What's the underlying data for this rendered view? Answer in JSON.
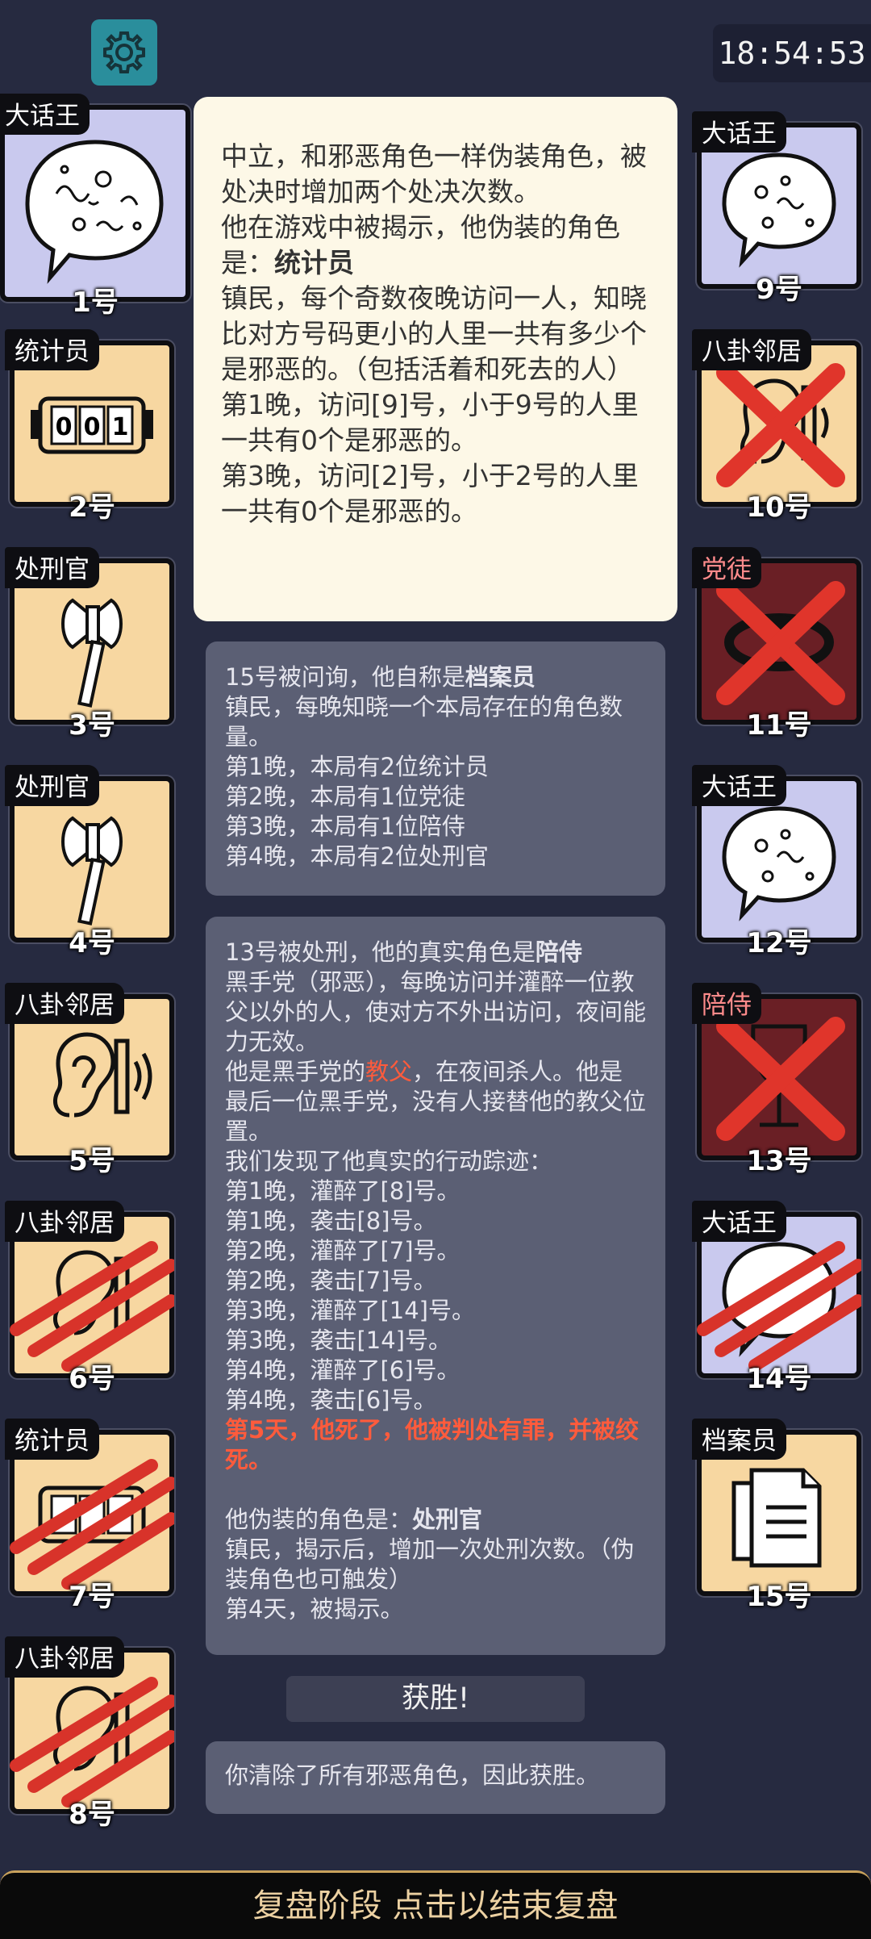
{
  "clock": "18:54:53",
  "left_cards": [
    {
      "role": "大话王",
      "num": "1号",
      "type": "liar",
      "state": "alive",
      "icon": "speech-bubble-icon"
    },
    {
      "role": "统计员",
      "num": "2号",
      "type": "town",
      "state": "alive",
      "icon": "counter-icon",
      "counter": "001"
    },
    {
      "role": "处刑官",
      "num": "3号",
      "type": "town",
      "state": "alive",
      "icon": "axe-icon"
    },
    {
      "role": "处刑官",
      "num": "4号",
      "type": "town",
      "state": "alive",
      "icon": "axe-icon"
    },
    {
      "role": "八卦邻居",
      "num": "5号",
      "type": "town",
      "state": "alive",
      "icon": "ear-icon"
    },
    {
      "role": "八卦邻居",
      "num": "6号",
      "type": "town",
      "state": "killed",
      "icon": "ear-icon"
    },
    {
      "role": "统计员",
      "num": "7号",
      "type": "town",
      "state": "killed",
      "icon": "counter-icon"
    },
    {
      "role": "八卦邻居",
      "num": "8号",
      "type": "town",
      "state": "killed",
      "icon": "ear-icon"
    }
  ],
  "right_cards": [
    {
      "role": "大话王",
      "num": "9号",
      "type": "liar",
      "state": "alive",
      "icon": "speech-bubble-icon"
    },
    {
      "role": "八卦邻居",
      "num": "10号",
      "type": "town",
      "state": "executed",
      "icon": "ear-icon"
    },
    {
      "role": "党徒",
      "num": "11号",
      "type": "evil",
      "state": "executed",
      "icon": "ring-icon"
    },
    {
      "role": "大话王",
      "num": "12号",
      "type": "liar",
      "state": "alive",
      "icon": "speech-bubble-icon"
    },
    {
      "role": "陪侍",
      "num": "13号",
      "type": "evil",
      "state": "executed",
      "icon": "wine-glass-icon"
    },
    {
      "role": "大话王",
      "num": "14号",
      "type": "liar",
      "state": "killed",
      "icon": "speech-bubble-icon"
    },
    {
      "role": "档案员",
      "num": "15号",
      "type": "town",
      "state": "alive",
      "icon": "documents-icon"
    }
  ],
  "main_panel": {
    "line1": "中立，和邪恶角色一样伪装角色，被处决时增加两个处决次数。",
    "line2a": "他在游戏中被揭示，他伪装的角色是：",
    "line2b": "统计员",
    "line3": "镇民，每个奇数夜晚访问一人，知晓比对方号码更小的人里一共有多少个是邪恶的。（包括活着和死去的人）",
    "line4": "第1晚，访问[9]号，小于9号的人里一共有0个是邪恶的。",
    "line5": "第3晚，访问[2]号，小于2号的人里一共有0个是邪恶的。"
  },
  "log1": {
    "head_a": "15号被问询，他自称是",
    "head_b": "档案员",
    "desc": "镇民，每晚知晓一个本局存在的角色数量。",
    "lines": [
      "第1晚，本局有2位统计员",
      "第2晚，本局有1位党徒",
      "第3晚，本局有1位陪侍",
      "第4晚，本局有2位处刑官"
    ]
  },
  "log2": {
    "head_a": "13号被处刑，他的真实角色是",
    "head_b": "陪侍",
    "desc": "黑手党（邪恶），每晚访问并灌醉一位教父以外的人，使对方不外出访问，夜间能力无效。",
    "boss_a": "他是黑手党的",
    "boss_b": "教父",
    "boss_c": "，在夜间杀人。他是最后一位黑手党，没有人接替他的教父位置。",
    "trace_head": "我们发现了他真实的行动踪迹：",
    "lines": [
      "第1晚，灌醉了[8]号。",
      "第1晚，袭击[8]号。",
      "第2晚，灌醉了[7]号。",
      "第2晚，袭击[7]号。",
      "第3晚，灌醉了[14]号。",
      "第3晚，袭击[14]号。",
      "第4晚，灌醉了[6]号。",
      "第4晚，袭击[6]号。"
    ],
    "death": "第5天，他死了，他被判处有罪，并被绞死。",
    "disguise_a": "他伪装的角色是：",
    "disguise_b": "处刑官",
    "disguise_desc": "镇民，揭示后，增加一次处刑次数。（伪装角色也可触发）",
    "revealed": "第4天，被揭示。"
  },
  "win_label": "获胜!",
  "win_text": "你清除了所有邪恶角色，因此获胜。",
  "bottom_bar": "复盘阶段 点击以结束复盘",
  "colors": {
    "town": "#f7d7a1",
    "liar": "#c9c9ee",
    "evil": "#6a1f25",
    "mark": "#e0352b",
    "accent": "#2a8e9c"
  }
}
